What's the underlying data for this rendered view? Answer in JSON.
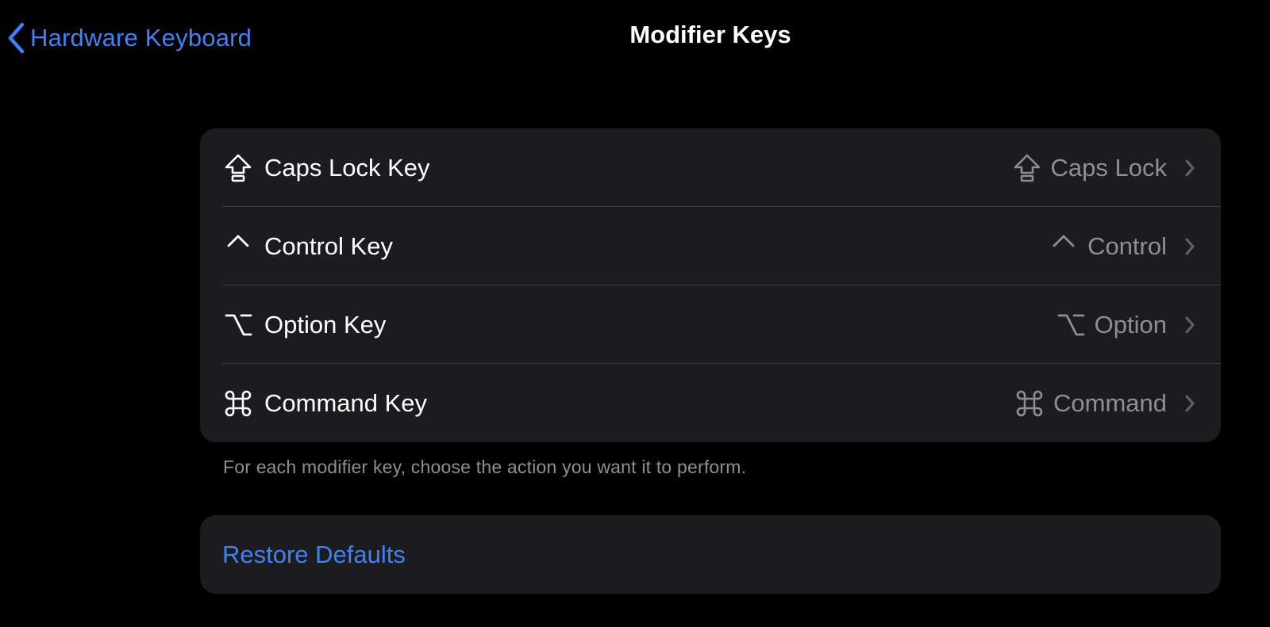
{
  "nav": {
    "back_label": "Hardware Keyboard",
    "title": "Modifier Keys"
  },
  "modifier_keys": [
    {
      "label": "Caps Lock Key",
      "icon": "caps-lock-icon",
      "value": "Caps Lock",
      "value_icon": "caps-lock-icon"
    },
    {
      "label": "Control Key",
      "icon": "control-icon",
      "value": "Control",
      "value_icon": "control-icon"
    },
    {
      "label": "Option Key",
      "icon": "option-icon",
      "value": "Option",
      "value_icon": "option-icon"
    },
    {
      "label": "Command Key",
      "icon": "command-icon",
      "value": "Command",
      "value_icon": "command-icon"
    }
  ],
  "footer_note": "For each modifier key, choose the action you want it to perform.",
  "restore_label": "Restore Defaults",
  "colors": {
    "background": "#000000",
    "group_background": "#1c1c1e",
    "accent": "#3d82f6",
    "secondary_text": "#8e8e93",
    "separator": "#3a3a3c"
  }
}
